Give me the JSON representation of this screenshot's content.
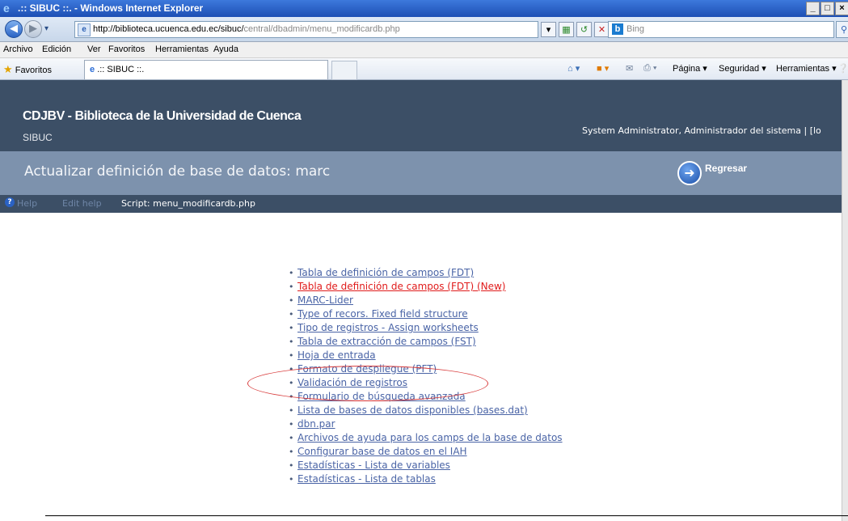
{
  "window": {
    "title": ".:: SIBUC ::. - Windows Internet Explorer",
    "controls": [
      "_",
      "□",
      "×"
    ]
  },
  "browser": {
    "url_host": "http://biblioteca.ucuenca.edu.ec/sibuc/",
    "url_path": "central/dbadmin/menu_modificardb.php",
    "search_placeholder": "Bing"
  },
  "menubar": [
    "Archivo",
    "Edición",
    "Ver",
    "Favoritos",
    "Herramientas",
    "Ayuda"
  ],
  "favbar": {
    "favorites_label": "Favoritos",
    "tab_title": ".:: SIBUC ::.",
    "commands": [
      "Página ▾",
      "Seguridad ▾",
      "Herramientas ▾"
    ]
  },
  "header": {
    "brand": "CDJBV - Biblioteca de la Universidad de Cuenca",
    "subtitle": "SIBUC",
    "user": "System Administrator, Administrador del sistema | [lo"
  },
  "section": {
    "title": "Actualizar definición de base de datos: marc",
    "back_label": "Regresar"
  },
  "helpbar": {
    "help": "Help",
    "edit_help": "Edit help",
    "script": "Script: menu_modificardb.php"
  },
  "menu_items": [
    {
      "label": "Tabla de definición de campos (FDT)",
      "highlight": false
    },
    {
      "label": "Tabla de definición de campos (FDT) (New)",
      "highlight": true
    },
    {
      "label": "MARC-Lider",
      "highlight": false
    },
    {
      "label": "Type of recors. Fixed field structure",
      "highlight": false
    },
    {
      "label": "Tipo de registros - Assign worksheets",
      "highlight": false
    },
    {
      "label": "Tabla de extracción de campos (FST)",
      "highlight": false
    },
    {
      "label": "Hoja de entrada",
      "highlight": false
    },
    {
      "label": "Formato de despliegue (PFT)",
      "highlight": false
    },
    {
      "label": "Validación de registros",
      "highlight": false
    },
    {
      "label": "Formulario de búsqueda avanzada",
      "highlight": false
    },
    {
      "label": "Lista de bases de datos disponibles (bases.dat)",
      "highlight": false
    },
    {
      "label": "dbn.par",
      "highlight": false
    },
    {
      "label": "Archivos de ayuda para los camps de la base de datos",
      "highlight": false
    },
    {
      "label": "Configurar base de datos en el IAH",
      "highlight": false
    },
    {
      "label": "Estadísticas - Lista de variables",
      "highlight": false
    },
    {
      "label": "Estadísticas - Lista de tablas",
      "highlight": false
    }
  ],
  "colors": {
    "header_bg": "#3c4f66",
    "section_bg": "#7d92ad",
    "link": "#4a64a6",
    "new_link": "#e01b1b",
    "annotation": "#d83a3a"
  }
}
